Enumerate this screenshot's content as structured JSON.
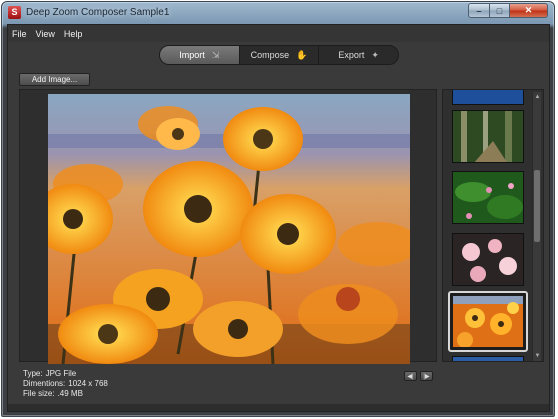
{
  "window": {
    "title": "Deep Zoom Composer Sample1",
    "app_icon_glyph": "S",
    "buttons": {
      "minimize": "–",
      "maximize": "□",
      "close": "✕"
    }
  },
  "menu": [
    "File",
    "View",
    "Help"
  ],
  "modes": [
    {
      "label": "Import",
      "icon": "import-icon",
      "glyph": "⇲",
      "active": true
    },
    {
      "label": "Compose",
      "icon": "hand-icon",
      "glyph": "✋",
      "active": false
    },
    {
      "label": "Export",
      "icon": "sparkle-icon",
      "glyph": "✦",
      "active": false
    }
  ],
  "add_image_label": "Add Image...",
  "file_info": {
    "type_label": "Type:",
    "type_value": "JPG File",
    "dimensions_label": "Dimentions:",
    "dimensions_value": "1024 x 768",
    "size_label": "File size:",
    "size_value": ".49 MB"
  },
  "nav": {
    "prev": "◀|",
    "next": "|▶"
  },
  "thumbnails": [
    {
      "name": "waterfall",
      "selected": false
    },
    {
      "name": "forest-path",
      "selected": false
    },
    {
      "name": "green-plant-flowers",
      "selected": false
    },
    {
      "name": "pink-lilies",
      "selected": false
    },
    {
      "name": "orange-daisies",
      "selected": true
    },
    {
      "name": "blue-scene",
      "selected": false
    }
  ],
  "colors": {
    "accent_active_tab": "#6a6a6a",
    "panel_bg": "#3a3a3a",
    "selected_border": "#d8d8d8"
  }
}
